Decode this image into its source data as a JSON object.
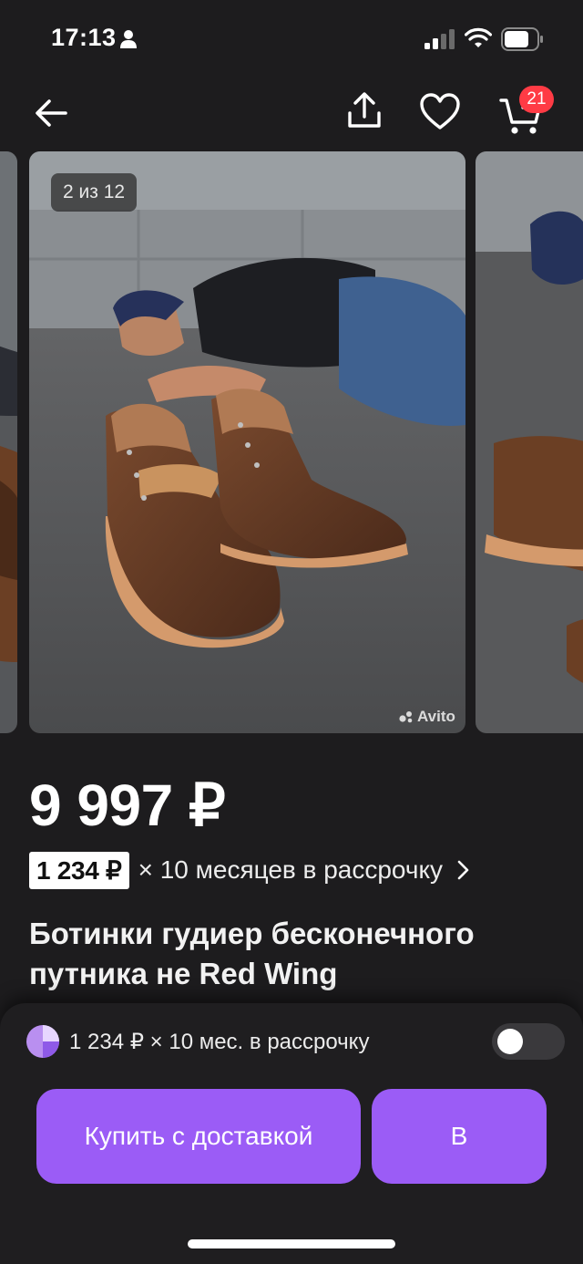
{
  "status_bar": {
    "time": "17:13",
    "icons": [
      "person-icon",
      "cellular-signal-icon",
      "wifi-icon",
      "battery-icon"
    ]
  },
  "toolbar": {
    "icons": [
      "arrow-left-icon",
      "share-icon",
      "heart-icon",
      "cart-icon"
    ],
    "cart_count": "21"
  },
  "gallery": {
    "counter": "2 из 12",
    "watermark": "Avito"
  },
  "listing": {
    "price": "9 997 ₽",
    "installment_amount": "1 234 ₽",
    "installment_text": "× 10 месяцев в рассрочку",
    "title": "Ботинки гудиер бесконечного путника не Red Wing"
  },
  "bottom_sheet": {
    "split_text": "1 234 ₽ × 10 мес. в рассрочку",
    "split_toggle_on": false,
    "buy_button_label": "Купить с доставкой",
    "second_button_label": "В"
  },
  "colors": {
    "background": "#1d1c1e",
    "accent": "#9b5cf6",
    "badge": "#ff3b45"
  }
}
